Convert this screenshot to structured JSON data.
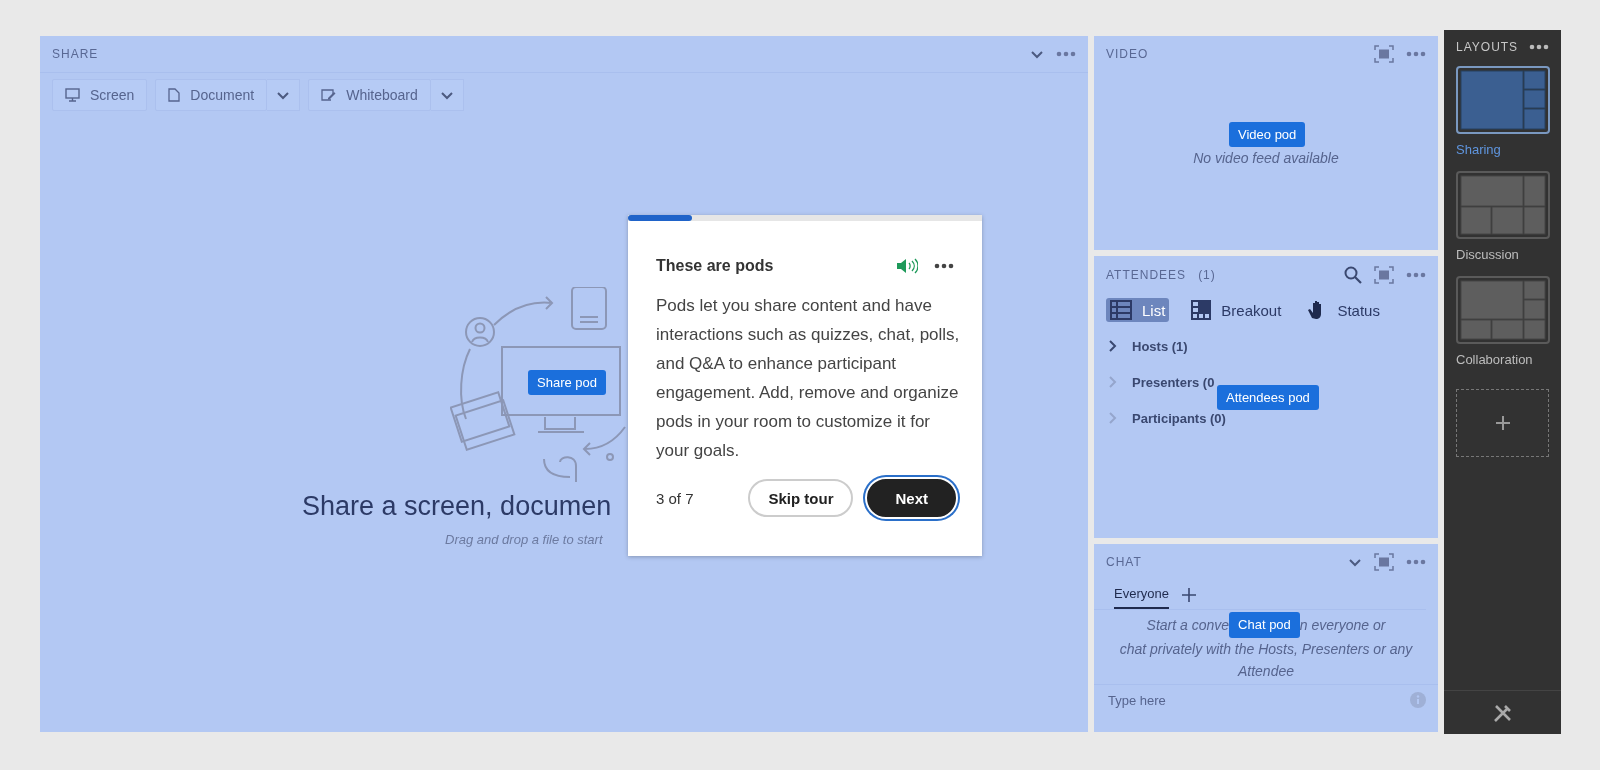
{
  "share_pod": {
    "title": "SHARE",
    "toolbar": [
      {
        "label": "Screen",
        "kind": "screen",
        "dropdown": false
      },
      {
        "label": "Document",
        "kind": "document",
        "dropdown": true
      },
      {
        "label": "Whiteboard",
        "kind": "whiteboard",
        "dropdown": true
      }
    ],
    "heading": "Share a screen, documen",
    "hint": "Drag and drop a file to start",
    "tag": "Share pod"
  },
  "video_pod": {
    "title": "VIDEO",
    "message": "No video feed available",
    "tag": "Video pod"
  },
  "attendees_pod": {
    "title": "ATTENDEES",
    "count": "(1)",
    "views": [
      {
        "label": "List",
        "kind": "list",
        "selected": true
      },
      {
        "label": "Breakout",
        "kind": "breakout",
        "selected": false
      },
      {
        "label": "Status",
        "kind": "status",
        "selected": false
      }
    ],
    "groups": [
      {
        "label": "Hosts (1)",
        "disabled": false,
        "expanded": false
      },
      {
        "label": "Presenters (0",
        "disabled": true,
        "expanded": false
      },
      {
        "label": "Participants (0)",
        "disabled": true,
        "expanded": false
      }
    ],
    "tag": "Attendees pod"
  },
  "chat_pod": {
    "title": "CHAT",
    "tabs": [
      {
        "label": "Everyone",
        "selected": true
      }
    ],
    "message_start": "Start a conve",
    "message_middle": "n everyone or",
    "message_end": "chat privately with the Hosts, Presenters or any Attendee",
    "input": {
      "placeholder": "Type here"
    },
    "tag": "Chat pod"
  },
  "layouts": {
    "title": "LAYOUTS",
    "items": [
      {
        "label": "Sharing",
        "kind": "sharing",
        "selected": true
      },
      {
        "label": "Discussion",
        "kind": "discussion",
        "selected": false
      },
      {
        "label": "Collaboration",
        "kind": "collaboration",
        "selected": false
      }
    ]
  },
  "tour": {
    "level": 0.18,
    "title": "These are pods",
    "body": "Pods let you share content and have interactions such as quizzes, chat, polls, and Q&A to enhance participant engagement. Add, remove and organize pods in your room to customize it for your goals.",
    "step": "3 of 7",
    "buttons": [
      {
        "label": "Skip tour",
        "kind": "secondary"
      },
      {
        "label": "Next",
        "kind": "primary"
      }
    ]
  }
}
